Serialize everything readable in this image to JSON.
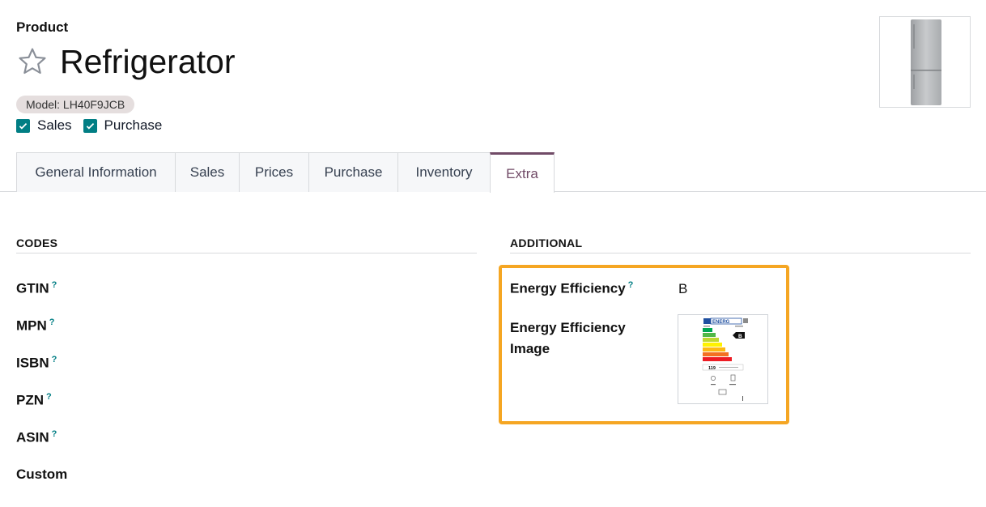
{
  "header": {
    "breadcrumb": "Product",
    "name": "Refrigerator",
    "model_badge": "Model: LH40F9JCB",
    "checks": [
      {
        "label": "Sales",
        "checked": true
      },
      {
        "label": "Purchase",
        "checked": true
      }
    ]
  },
  "tabs": [
    {
      "label": "General Information",
      "active": false
    },
    {
      "label": "Sales",
      "active": false
    },
    {
      "label": "Prices",
      "active": false
    },
    {
      "label": "Purchase",
      "active": false
    },
    {
      "label": "Inventory",
      "active": false
    },
    {
      "label": "Extra",
      "active": true
    }
  ],
  "codes": {
    "title": "CODES",
    "fields": [
      {
        "label": "GTIN",
        "help": "?"
      },
      {
        "label": "MPN",
        "help": "?"
      },
      {
        "label": "ISBN",
        "help": "?"
      },
      {
        "label": "PZN",
        "help": "?"
      },
      {
        "label": "ASIN",
        "help": "?"
      },
      {
        "label": "Custom",
        "help": ""
      }
    ]
  },
  "additional": {
    "title": "ADDITIONAL",
    "energy_efficiency_label": "Energy Efficiency",
    "energy_efficiency_help": "?",
    "energy_efficiency_value": "B",
    "energy_efficiency_image_label": "Energy Efficiency\nImage",
    "label_image": {
      "header": "ENERG",
      "class": "B",
      "consumption": "119"
    }
  },
  "colors": {
    "accent": "#714b67",
    "checkbox": "#017e84",
    "highlight": "#f5a623"
  }
}
